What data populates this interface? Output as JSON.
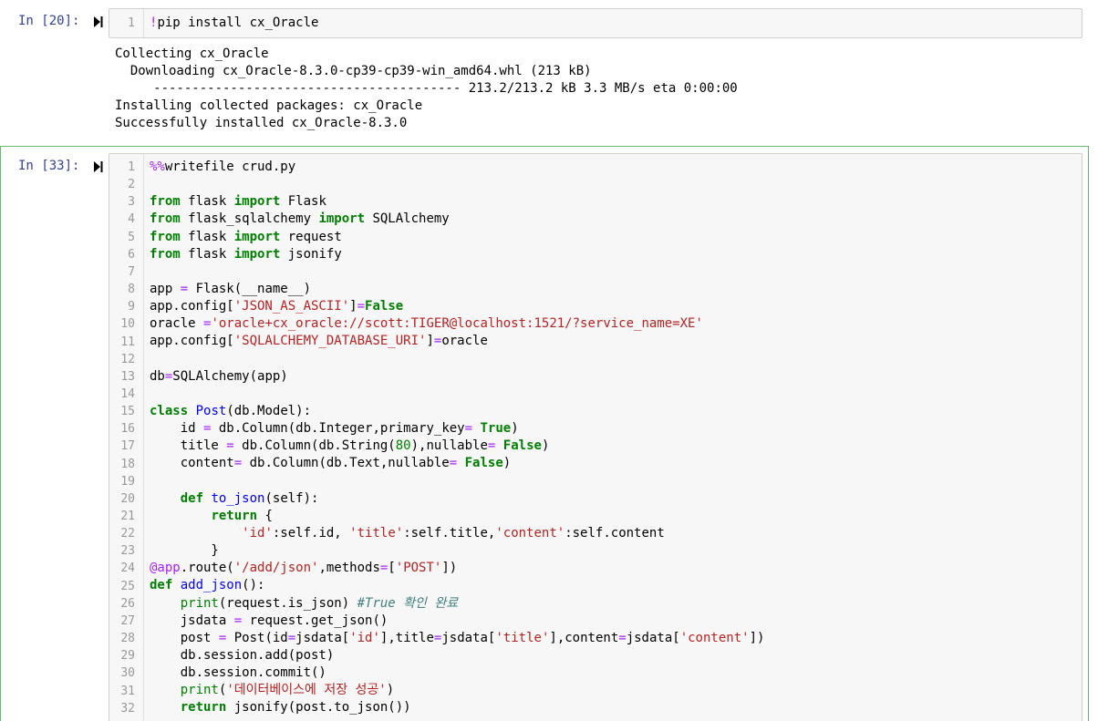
{
  "cells": [
    {
      "prompt": "In [20]:",
      "code_lines": [
        "!pip install cx_Oracle"
      ],
      "line_numbers": [
        "1"
      ],
      "output_lines": [
        "Collecting cx_Oracle",
        "  Downloading cx_Oracle-8.3.0-cp39-cp39-win_amd64.whl (213 kB)",
        "     ---------------------------------------- 213.2/213.2 kB 3.3 MB/s eta 0:00:00",
        "Installing collected packages: cx_Oracle",
        "Successfully installed cx_Oracle-8.3.0"
      ]
    },
    {
      "prompt": "In [33]:",
      "line_numbers": [
        "1",
        "2",
        "3",
        "4",
        "5",
        "6",
        "7",
        "8",
        "9",
        "10",
        "11",
        "12",
        "13",
        "14",
        "15",
        "16",
        "17",
        "18",
        "19",
        "20",
        "21",
        "22",
        "23",
        "24",
        "25",
        "26",
        "27",
        "28",
        "29",
        "30",
        "31",
        "32"
      ],
      "code_lines": [
        "%%writefile crud.py",
        "",
        "from flask import Flask",
        "from flask_sqlalchemy import SQLAlchemy",
        "from flask import request",
        "from flask import jsonify",
        "",
        "app = Flask(__name__)",
        "app.config['JSON_AS_ASCII']=False",
        "oracle ='oracle+cx_oracle://scott:TIGER@localhost:1521/?service_name=XE'",
        "app.config['SQLALCHEMY_DATABASE_URI']=oracle",
        "",
        "db=SQLAlchemy(app)",
        "",
        "class Post(db.Model):",
        "    id = db.Column(db.Integer,primary_key= True)",
        "    title = db.Column(db.String(80),nullable= False)",
        "    content= db.Column(db.Text,nullable= False)",
        "",
        "    def to_json(self):",
        "        return {",
        "            'id':self.id, 'title':self.title,'content':self.content",
        "        }",
        "@app.route('/add/json',methods=['POST'])",
        "def add_json():",
        "    print(request.is_json) #True 확인 완료",
        "    jsdata = request.get_json()",
        "    post = Post(id=jsdata['id'],title=jsdata['title'],content=jsdata['content'])",
        "    db.session.add(post)",
        "    db.session.commit()",
        "    print('데이터베이스에 저장 성공')",
        "    return jsonify(post.to_json())"
      ]
    }
  ],
  "colors": {
    "prompt": "#303f9f",
    "selected_border": "#66bb6a",
    "keyword": "#008000",
    "string": "#ba2121",
    "magic": "#aa22ff",
    "definition": "#0000ff",
    "comment": "#408080"
  },
  "icons": {
    "run": "run-cell-icon"
  }
}
